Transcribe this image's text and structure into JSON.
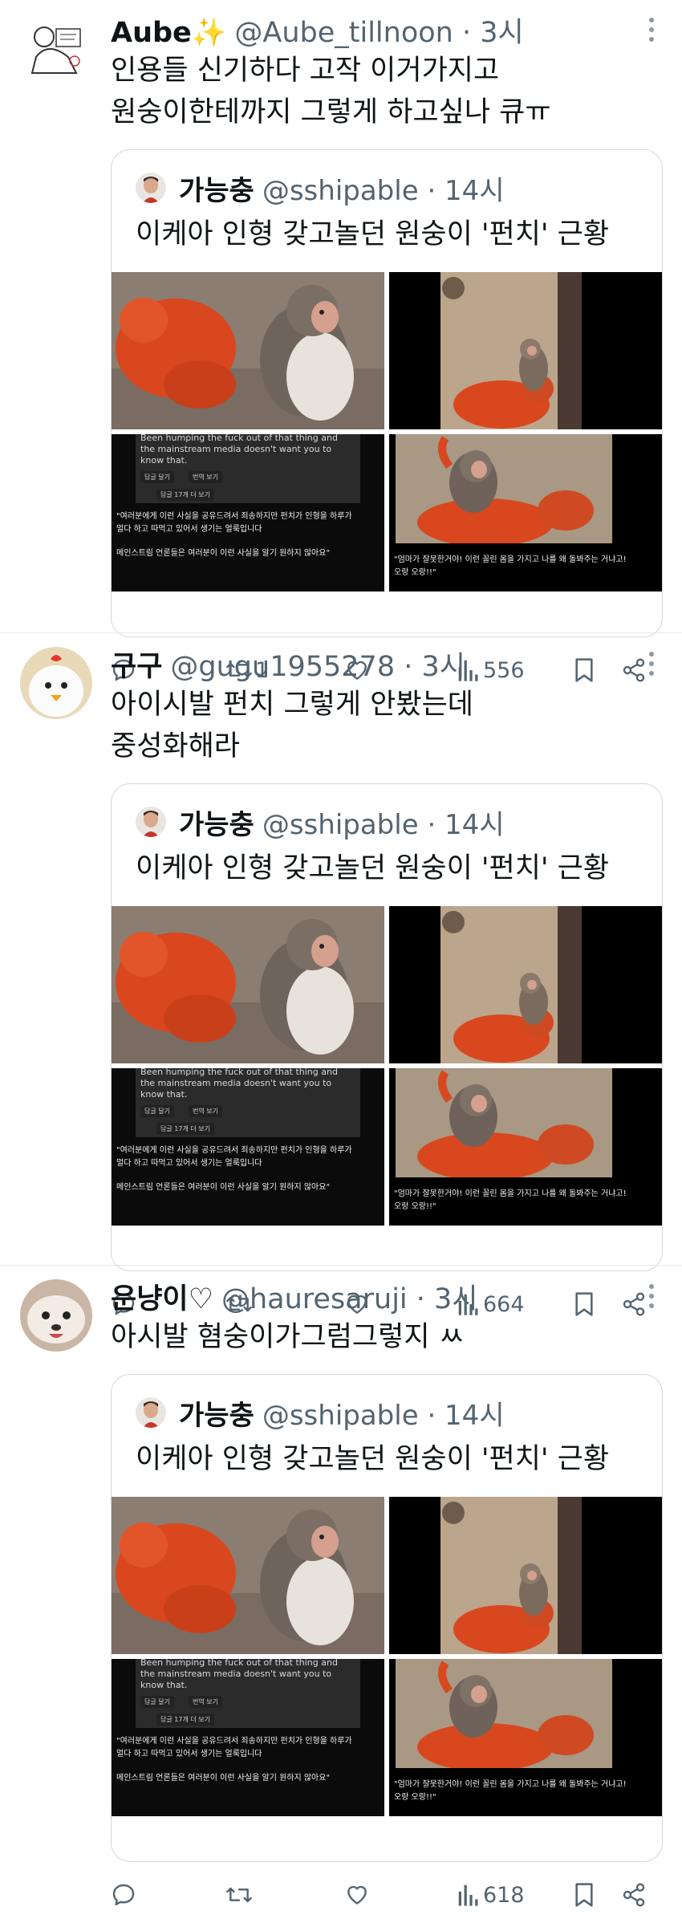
{
  "tweets": [
    {
      "name": "Aube✨",
      "handle": "@Aube_tillnoon · 3시",
      "text_lines": [
        "인용들 신기하다 고작 이거가지고",
        "원숭이한테까지 그렇게 하고싶나 큐ㅠ"
      ],
      "quote": {
        "name": "가능충",
        "handle": "@sshipable · 14시",
        "text": "이케아 인형 갖고놀던 원숭이 '펀치' 근황"
      },
      "retweets": "1",
      "views": "556"
    },
    {
      "name": "구구",
      "handle": "@gugu1955278 · 3시",
      "text_lines": [
        "아이시발 펀치 그렇게 안봤는데",
        "중성화해라"
      ],
      "quote": {
        "name": "가능충",
        "handle": "@sshipable · 14시",
        "text": "이케아 인형 갖고놀던 원숭이 '펀치' 근황"
      },
      "retweets": "",
      "views": "664"
    },
    {
      "name": "운냥이♡",
      "handle": "@hauresaruji · 3시",
      "text_lines": [
        "아시발 혐숭이가그럼그렇지 ㅆ"
      ],
      "quote": {
        "name": "가능충",
        "handle": "@sshipable · 14시",
        "text": "이케아 인형 갖고놀던 원숭이 '펀치' 근황"
      },
      "retweets": "",
      "views": "618"
    }
  ],
  "media_captions": {
    "c3_lines": [
      "Been humping the fuck out of that thing and",
      "the mainstream media doesn't want you to",
      "know that."
    ],
    "c3_btn1": "답글 달기",
    "c3_btn2": "번역 보기",
    "c3_more": "답글 17개 더 보기",
    "c3_kr1": "\"여러분에게 이런 사실을 공유드려서 죄송하지만 펀치가 인형을 하루가",
    "c3_kr2": "멀다 하고 따먹고 있어서 생기는 얼룩입니다",
    "c3_kr3": "메인스트림 언론들은 여러분이 이런 사실을 알기 원하지 않아요\"",
    "c4_kr1": "\"엄마가 잘못한거야! 이런 꼴린 몸을 가지고 나를 왜 돌봐주는 거냐고!",
    "c4_kr2": "오랑 오랑!!\""
  },
  "colors": {
    "text": "#0f1419",
    "secondary": "#536471",
    "border": "#cfd9de",
    "divider": "#e6e9ec",
    "orange_plush": "#d9471e"
  },
  "icons": [
    "reply-icon",
    "retweet-icon",
    "like-icon",
    "views-icon",
    "bookmark-icon",
    "share-icon",
    "more-icon"
  ]
}
